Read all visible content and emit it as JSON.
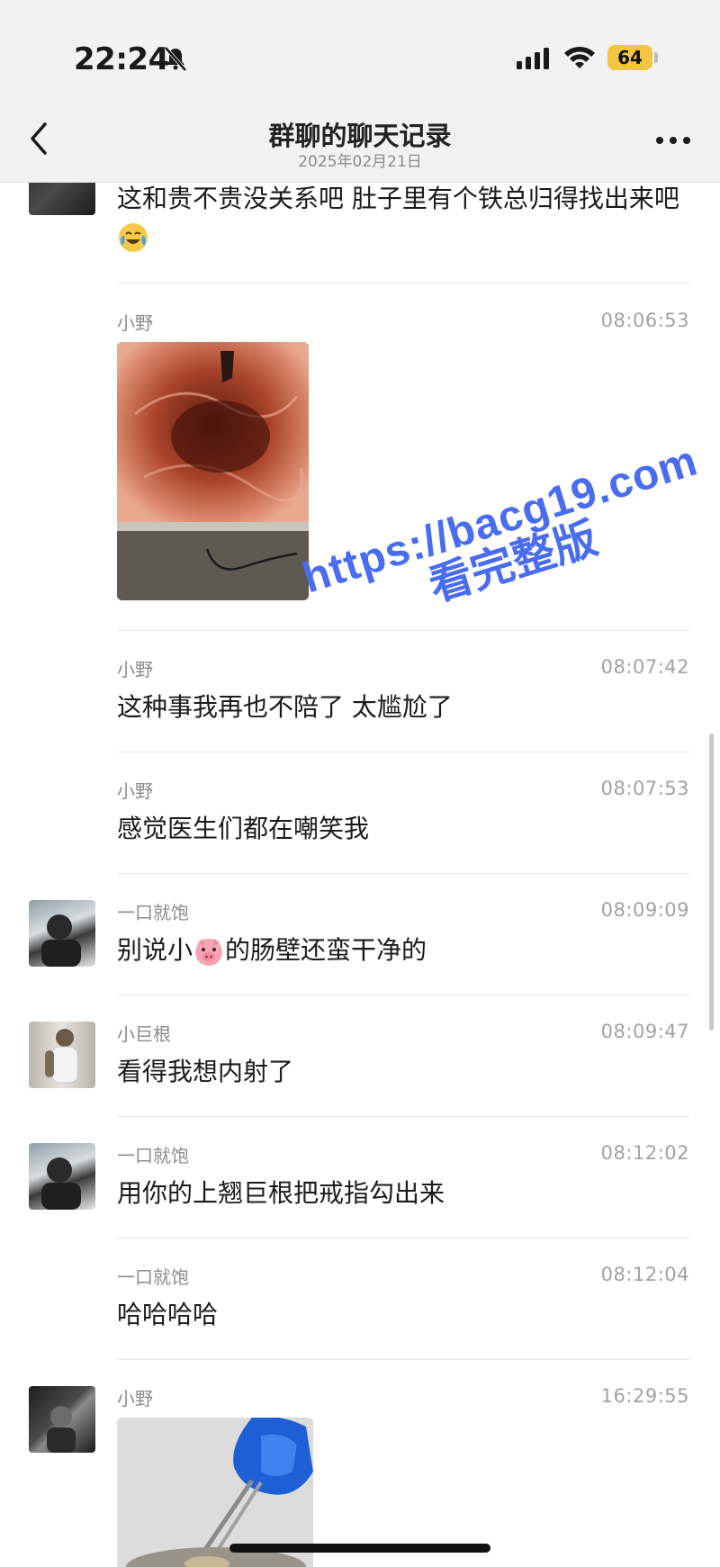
{
  "status_bar": {
    "time": "22:24",
    "battery": "64"
  },
  "header": {
    "title": "群聊的聊天记录",
    "date": "2025年02月21日"
  },
  "messages": [
    {
      "name": "",
      "time": "",
      "text": "这和贵不贵没关系吧 肚子里有个铁总归得找出来吧"
    },
    {
      "name": "小野",
      "time": "08:06:53"
    },
    {
      "name": "小野",
      "time": "08:07:42",
      "text": "这种事我再也不陪了 太尴尬了"
    },
    {
      "name": "小野",
      "time": "08:07:53",
      "text": "感觉医生们都在嘲笑我"
    },
    {
      "name": "一口就饱",
      "time": "08:09:09",
      "text_before": "别说小",
      "text_after": "的肠壁还蛮干净的"
    },
    {
      "name": "小巨根",
      "time": "08:09:47",
      "text": "看得我想内射了"
    },
    {
      "name": "一口就饱",
      "time": "08:12:02",
      "text": "用你的上翘巨根把戒指勾出来"
    },
    {
      "name": "一口就饱",
      "time": "08:12:04",
      "text": "哈哈哈哈"
    },
    {
      "name": "小野",
      "time": "16:29:55"
    }
  ],
  "watermark": {
    "line1": "https://bacg19.com",
    "line2": "看完整版"
  },
  "colors": {
    "watermark": "#4a6cf0",
    "battery": "#f4c543"
  }
}
